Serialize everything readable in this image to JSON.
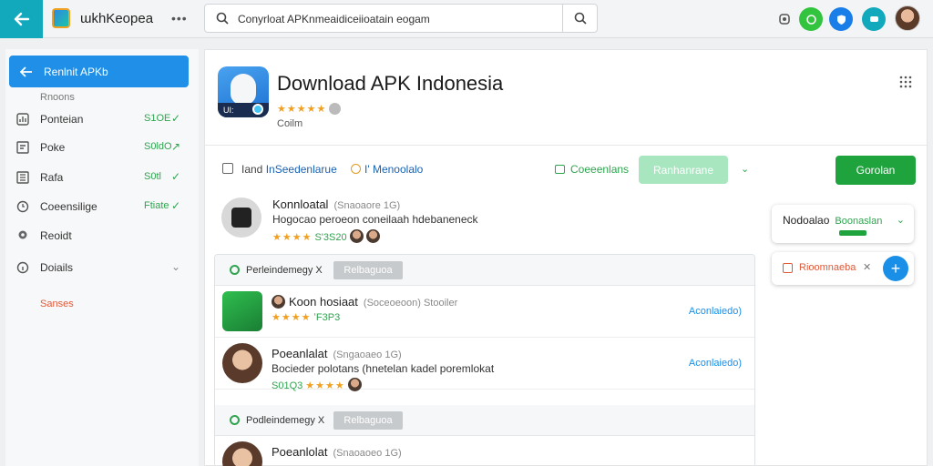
{
  "topbar": {
    "app_name": "ɯkhKeopea",
    "search_value": "Conyrloat APKnmeaidiceiioatain eogam",
    "colors": {
      "accent": "#12a9bd"
    }
  },
  "sidebar": {
    "active_label": "Renlnit APKb",
    "sub_label": "Rnoons",
    "items": [
      {
        "label": "Ponteian",
        "value": "S1OE",
        "trend": "✓",
        "icon": "chart-icon"
      },
      {
        "label": "Poke",
        "value": "S0ldO",
        "trend": "↗",
        "icon": "doc-icon"
      },
      {
        "label": "Rafa",
        "value": "S0tl",
        "trend": "✓",
        "icon": "list-icon"
      },
      {
        "label": "Coeensilige",
        "value": "Ftiate",
        "trend": "✓",
        "icon": "clock-icon"
      },
      {
        "label": "Reoidt",
        "value": "",
        "trend": "",
        "icon": "pin-icon"
      },
      {
        "label": "Doiails",
        "value": "",
        "trend": "⌄",
        "icon": "info-icon"
      }
    ],
    "link_label": "Sanses"
  },
  "app": {
    "title": "Download APK Indonesia",
    "stars": "★★★★★",
    "sub": "Coilm",
    "icon_badge": "UI:"
  },
  "toolbar": {
    "checkbox_label_prefix": "Iand",
    "checkbox_label_link": "InSeedenlarue",
    "filter_label": "I' Menoolalo",
    "share_label": "Coeeenlans",
    "light_button": "Ranhanrane",
    "green_button": "Gorolan"
  },
  "main_review": {
    "name": "Konnloatal",
    "meta": "(Snaoaore 1G)",
    "text": "Hogocao peroeon coneilaah hdebaneneck",
    "stars": "★★★★",
    "count": "S'3S20"
  },
  "groups": [
    {
      "label": "Perleindemegy X",
      "tag": "Relbaguoa"
    },
    {
      "label": "Podleindemegy X",
      "tag": "Relbaguoa"
    }
  ],
  "rows": [
    {
      "name": "Koon hosiaat",
      "meta": "(Soceoeoon) Stooiler",
      "stars": "★★★★",
      "count": "ʻF3P3",
      "action": "Aconlaiedo)",
      "thumb": "app"
    },
    {
      "name": "Poeanlalat",
      "meta": "(Sngaoaeo 1G)",
      "text": "Bocieder polotans (hnetelan kadel poremlokat",
      "stars": "★★★★",
      "count": "S01Q3",
      "action": "Aconlaiedo)",
      "thumb": "person"
    },
    {
      "name": "Poeanlolat",
      "meta": "(Snaoaoeo 1G)",
      "thumb": "person"
    }
  ],
  "float_card": {
    "label": "Nodoalao",
    "value": "Boonaslan"
  },
  "float_card2": {
    "label": "Rioomnaeba",
    "close": "✕"
  }
}
